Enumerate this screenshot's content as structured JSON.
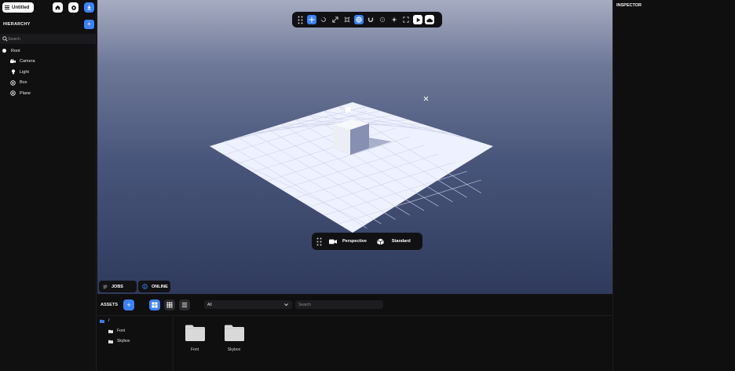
{
  "app": {
    "project_name": "Untitled"
  },
  "hierarchy": {
    "title": "HIERARCHY",
    "search_placeholder": "Search",
    "root": "Root",
    "children": [
      {
        "label": "Camera",
        "icon": "camera-icon"
      },
      {
        "label": "Light",
        "icon": "bulb-icon"
      },
      {
        "label": "Box",
        "icon": "mesh-icon"
      },
      {
        "label": "Plane",
        "icon": "mesh-icon"
      }
    ]
  },
  "viewport": {
    "camera_mode": "Perspective",
    "shading_mode": "Standard"
  },
  "bottom_tabs": {
    "jobs": "JOBS",
    "online": "ONLINE"
  },
  "inspector": {
    "title": "INSPECTOR"
  },
  "assets": {
    "title": "ASSETS",
    "filter_value": "All",
    "search_placeholder": "Search",
    "path_root": "/",
    "folders": [
      "Font",
      "Skybox"
    ],
    "items": [
      "Font",
      "Skybox"
    ]
  },
  "colors": {
    "accent": "#3b82f6",
    "panel": "#101011",
    "plane": "#eef1ff"
  }
}
